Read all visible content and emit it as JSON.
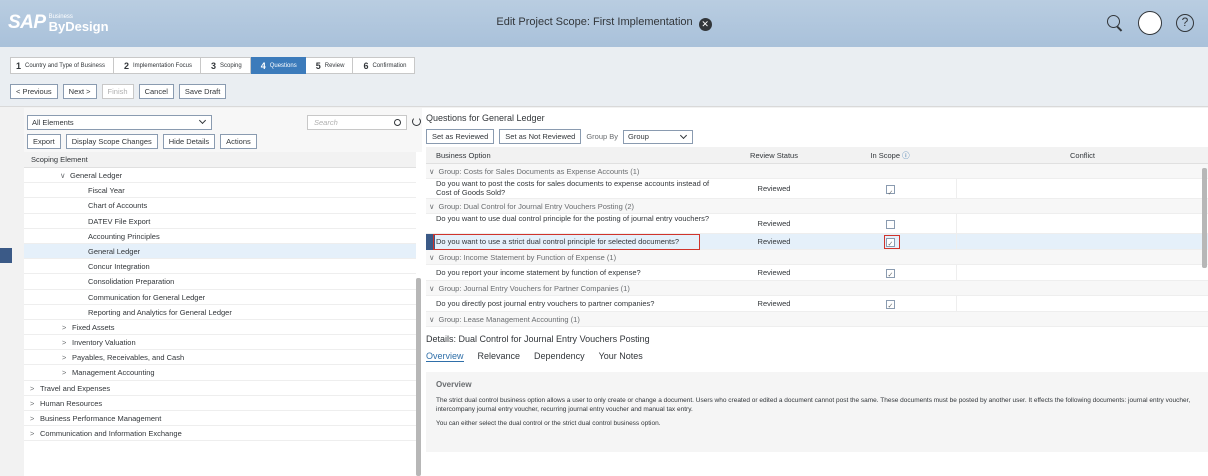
{
  "shell": {
    "logo_main": "SAP",
    "logo_small": "Business",
    "logo_product": "ByDesign",
    "title": "Edit Project Scope: First Implementation"
  },
  "wizard": {
    "steps": [
      {
        "num": "1",
        "label": "Country and Type of Business"
      },
      {
        "num": "2",
        "label": "Implementation Focus"
      },
      {
        "num": "3",
        "label": "Scoping"
      },
      {
        "num": "4",
        "label": "Questions"
      },
      {
        "num": "5",
        "label": "Review"
      },
      {
        "num": "6",
        "label": "Confirmation"
      }
    ],
    "buttons": {
      "previous": "< Previous",
      "next": "Next >",
      "finish": "Finish",
      "cancel": "Cancel",
      "save_draft": "Save Draft"
    }
  },
  "left": {
    "filter_value": "All Elements",
    "search_placeholder": "Search",
    "tools": {
      "export": "Export",
      "display_changes": "Display Scope Changes",
      "hide_details": "Hide Details",
      "actions": "Actions"
    },
    "column_header": "Scoping Element",
    "tree": [
      {
        "label": "General Ledger",
        "caret": "∨",
        "indent": 2
      },
      {
        "label": "Fiscal Year",
        "caret": "",
        "indent": 4
      },
      {
        "label": "Chart of Accounts",
        "caret": "",
        "indent": 4
      },
      {
        "label": "DATEV File Export",
        "caret": "",
        "indent": 4
      },
      {
        "label": "Accounting Principles",
        "caret": "",
        "indent": 4
      },
      {
        "label": "General Ledger",
        "caret": "",
        "indent": 4
      },
      {
        "label": "Concur Integration",
        "caret": "",
        "indent": 4
      },
      {
        "label": "Consolidation Preparation",
        "caret": "",
        "indent": 4
      },
      {
        "label": "Communication for General Ledger",
        "caret": "",
        "indent": 4
      },
      {
        "label": "Reporting and Analytics for General Ledger",
        "caret": "",
        "indent": 4
      },
      {
        "label": "Fixed Assets",
        "caret": ">",
        "indent": 2
      },
      {
        "label": "Inventory Valuation",
        "caret": ">",
        "indent": 2
      },
      {
        "label": "Payables, Receivables, and Cash",
        "caret": ">",
        "indent": 2
      },
      {
        "label": "Management Accounting",
        "caret": ">",
        "indent": 2
      },
      {
        "label": "Travel and Expenses",
        "caret": ">",
        "indent": 0
      },
      {
        "label": "Human Resources",
        "caret": ">",
        "indent": 0
      },
      {
        "label": "Business Performance Management",
        "caret": ">",
        "indent": 0
      },
      {
        "label": "Communication and Information Exchange",
        "caret": ">",
        "indent": 0
      }
    ]
  },
  "right": {
    "title": "Questions for General Ledger",
    "set_reviewed": "Set as Reviewed",
    "set_not_reviewed": "Set as Not Reviewed",
    "group_by_label": "Group By",
    "group_by_value": "Group",
    "columns": {
      "option": "Business Option",
      "status": "Review Status",
      "scope": "In Scope",
      "conflict": "Conflict"
    },
    "rows": [
      {
        "type": "group",
        "text": "Group: Costs for Sales Documents as Expense Accounts (1)"
      },
      {
        "type": "q2",
        "text": "Do you want to post the costs for sales documents to expense accounts instead of Cost of Goods Sold?",
        "status": "Reviewed",
        "checked": true
      },
      {
        "type": "group",
        "text": "Group: Dual Control for Journal Entry Vouchers Posting (2)"
      },
      {
        "type": "q2",
        "text": "Do you want to use dual control principle for the posting of journal entry vouchers?",
        "status": "Reviewed",
        "checked": false
      },
      {
        "type": "q",
        "text": "Do you want to use a strict dual control principle for selected documents?",
        "status": "Reviewed",
        "checked": true,
        "highlight": true
      },
      {
        "type": "group",
        "text": "Group: Income Statement by Function of Expense (1)"
      },
      {
        "type": "q",
        "text": "Do you report your income statement by function of expense?",
        "status": "Reviewed",
        "checked": true
      },
      {
        "type": "group",
        "text": "Group: Journal Entry Vouchers for Partner Companies (1)"
      },
      {
        "type": "q",
        "text": "Do you directly post journal entry vouchers to partner companies?",
        "status": "Reviewed",
        "checked": true
      },
      {
        "type": "group",
        "text": "Group: Lease Management Accounting (1)"
      }
    ],
    "details": {
      "title": "Details: Dual Control for Journal Entry Vouchers Posting",
      "tabs": [
        "Overview",
        "Relevance",
        "Dependency",
        "Your Notes"
      ],
      "overview_heading": "Overview",
      "p1": "The strict dual control business option allows a user to only create or change a document. Users who created or edited a document cannot post the same. These documents must be posted by another user. It effects the following documents: journal entry voucher, intercompany journal entry voucher, recurring journal entry voucher and manual tax entry.",
      "p2": "You can either select the dual control or the strict dual control business option."
    }
  }
}
